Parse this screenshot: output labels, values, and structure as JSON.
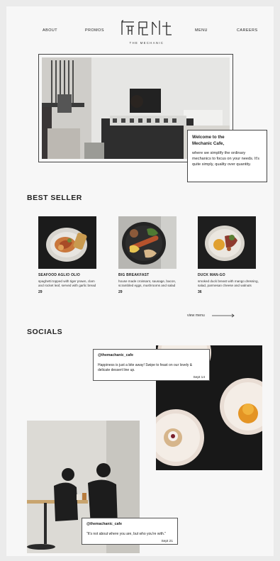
{
  "nav": {
    "about": "ABOUT",
    "promos": "PROMOS",
    "menu": "MENU",
    "careers": "CAREERS"
  },
  "logo": {
    "mark": "Mechanic logo",
    "subtitle": "THE MECHANIC"
  },
  "hero": {
    "title": "Welcome to the Mechanic Cafe,",
    "body": "where we simplify the ordinary mechanics to focus on your needs. It's quite simply, quality over quantity."
  },
  "best_seller": {
    "title": "BEST SELLER",
    "items": [
      {
        "name": "SEAFOOD AGLIO OLIO",
        "desc": "spaghetti topped with tiger prawn, clam and rocket leaf, served with garlic bread",
        "price": "29"
      },
      {
        "name": "BIG BREAKFAST",
        "desc": "house made croissant, sausage, bacon, scrambled eggs, mushrooms and salad",
        "price": "29"
      },
      {
        "name": "DUCK MAN-GO",
        "desc": "smoked duck breast with mango dressing, salad, parmesan cheese and walnuts",
        "price": "36"
      }
    ],
    "view_menu": "view menu"
  },
  "socials": {
    "title": "SOCIALS",
    "posts": [
      {
        "handle": "@themachanic_cafe",
        "text": "Happiness is just a bite away! Swipe to feast on our lovely & delicate dessert line up.",
        "date": "Sept 14"
      },
      {
        "handle": "@themachanic_cafe",
        "text": "\"It's not about where you are, but who you're with.\"",
        "date": "Sept 21"
      }
    ]
  },
  "colors": {
    "background": "#f7f7f7",
    "text": "#1e1e1e",
    "border": "#444444"
  }
}
